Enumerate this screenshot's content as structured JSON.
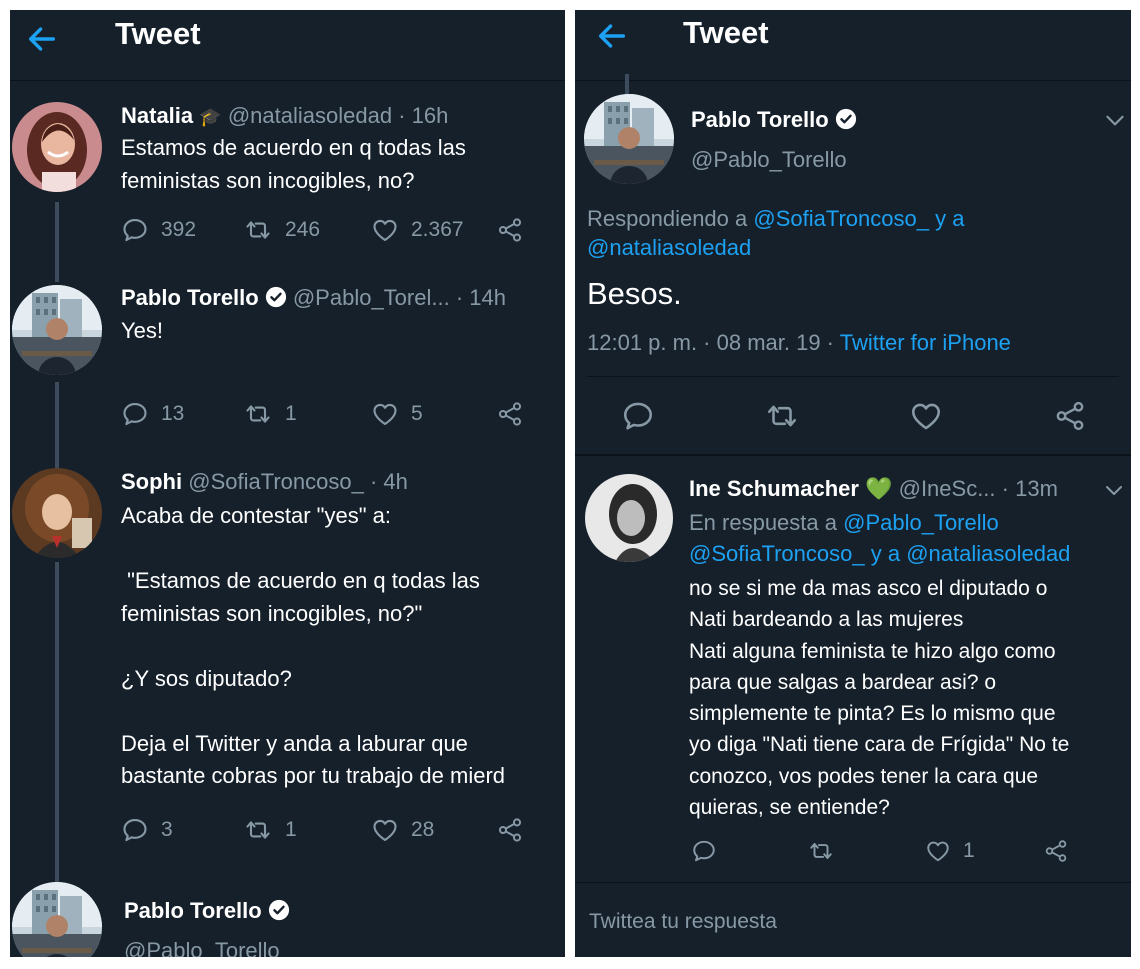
{
  "left": {
    "header_title": "Tweet",
    "tweets": [
      {
        "name": "Natalia",
        "handle": "@nataliasoledad",
        "time": "· 16h",
        "text": "Estamos de acuerdo en q todas las\nfeministas son incogibles, no?",
        "replies": "392",
        "retweets": "246",
        "likes": "2.367"
      },
      {
        "name": "Pablo Torello",
        "handle": "@Pablo_Torel...",
        "time": "· 14h",
        "text": "Yes!",
        "replies": "13",
        "retweets": "1",
        "likes": "5"
      },
      {
        "name": "Sophi",
        "handle": "@SofiaTroncoso_",
        "time": "· 4h",
        "text": "Acaba de contestar \"yes\" a:\n\n \"Estamos de acuerdo en q todas las\nfeministas son incogibles, no?\"\n\n¿Y sos diputado?\n\nDeja el Twitter y anda a laburar que\nbastante cobras por tu trabajo de mierd",
        "replies": "3",
        "retweets": "1",
        "likes": "28"
      }
    ],
    "partial_tweet": {
      "name": "Pablo Torello",
      "handle": "@Pablo_Torello"
    }
  },
  "right": {
    "header_title": "Tweet",
    "main_tweet": {
      "name": "Pablo Torello",
      "handle": "@Pablo_Torello",
      "replying_prefix": "Respondiendo a ",
      "replying_user1": "@SofiaTroncoso_",
      "replying_and": " y a",
      "replying_user2": "@nataliasoledad",
      "text": "Besos.",
      "timestamp": "12:01 p. m. · 08 mar. 19 · ",
      "source": "Twitter for iPhone"
    },
    "reply_tweet": {
      "name": "Ine Schumacher",
      "emoji": "💚",
      "handle": "@IneSc...",
      "time": "· 13m",
      "in_reply_prefix": "En respuesta a ",
      "in_reply_user1": "@Pablo_Torello",
      "in_reply_user2": "@SofiaTroncoso_",
      "in_reply_and": " y a ",
      "in_reply_user3": "@nataliasoledad",
      "text": "no se si me da mas asco el diputado o\nNati bardeando a las mujeres\nNati alguna feminista te hizo algo como\npara que salgas a bardear asi? o\nsimplemente te pinta? Es lo mismo que\nyo diga \"Nati tiene cara de Frígida\" No te\nconozco, vos podes tener la cara que\nquieras, se entiende?",
      "likes": "1"
    },
    "reply_placeholder": "Twittea tu respuesta"
  },
  "colors": {
    "background": "#15202b",
    "accent": "#1da1f2",
    "muted": "#8899a6",
    "like_heart_green": "#77dd2b"
  },
  "icons": [
    "back-arrow-icon",
    "reply-icon",
    "retweet-icon",
    "like-icon",
    "share-icon",
    "verified-icon",
    "chevron-down-icon",
    "graduation-cap-icon",
    "green-heart-icon"
  ]
}
